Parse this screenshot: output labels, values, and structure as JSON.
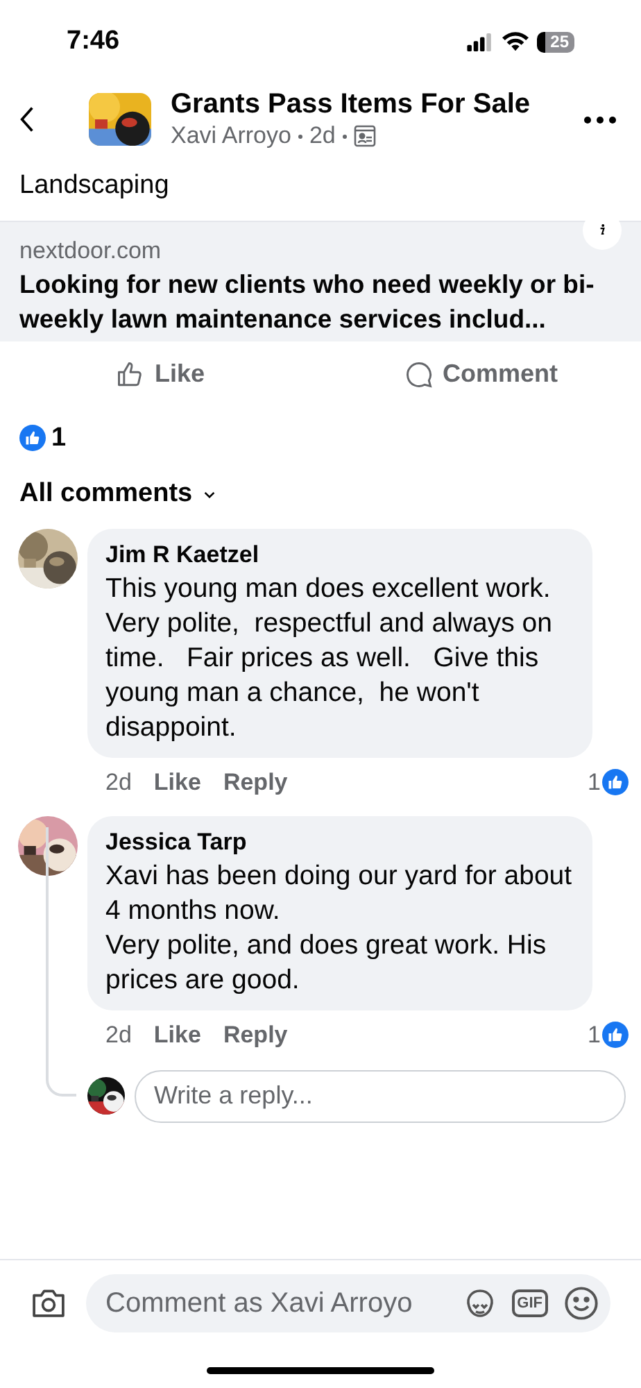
{
  "status_bar": {
    "time": "7:46",
    "battery": "25"
  },
  "header": {
    "group": "Grants Pass Items For Sale",
    "author": "Xavi Arroyo",
    "age": "2d"
  },
  "post": {
    "text": "Landscaping",
    "link": {
      "domain": "nextdoor.com",
      "title": "Looking for new clients who need weekly or bi-weekly lawn maintenance services includ..."
    }
  },
  "actions": [
    {
      "kind": "like",
      "label": "Like"
    },
    {
      "kind": "comment",
      "label": "Comment"
    }
  ],
  "reactions": {
    "count": "1"
  },
  "sort": {
    "label": "All comments"
  },
  "comments": [
    {
      "author": "Jim R Kaetzel",
      "text": "This young man does excellent work. Very polite,  respectful and always on time.   Fair prices as well.   Give this young man a chance,  he won't disappoint.",
      "age": "2d",
      "like": "Like",
      "reply": "Reply",
      "likes": "1",
      "has_reply_box": false
    },
    {
      "author": "Jessica Tarp",
      "text": "Xavi has been doing our yard for about 4 months now.\nVery polite, and does great work. His prices are good.",
      "age": "2d",
      "like": "Like",
      "reply": "Reply",
      "likes": "1",
      "has_reply_box": true
    }
  ],
  "reply_box": {
    "placeholder": "Write a reply..."
  },
  "composer": {
    "placeholder": "Comment as Xavi Arroyo",
    "gif_label": "GIF"
  }
}
